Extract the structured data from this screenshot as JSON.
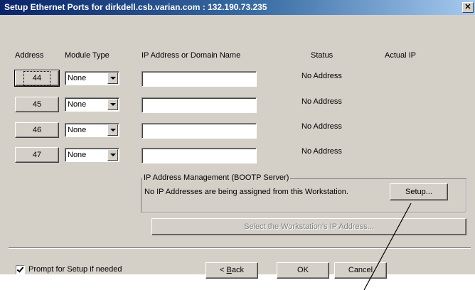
{
  "window": {
    "title": "Setup Ethernet Ports for dirkdell.csb.varian.com : 132.190.73.235",
    "close_glyph": "✕"
  },
  "columns": {
    "address": "Address",
    "module_type": "Module Type",
    "ip_name": "IP Address or Domain Name",
    "status": "Status",
    "actual_ip": "Actual IP"
  },
  "ports": [
    {
      "address": "44",
      "module": "None",
      "ip": "",
      "status": "No Address"
    },
    {
      "address": "45",
      "module": "None",
      "ip": "",
      "status": "No Address"
    },
    {
      "address": "46",
      "module": "None",
      "ip": "",
      "status": "No Address"
    },
    {
      "address": "47",
      "module": "None",
      "ip": "",
      "status": "No Address"
    }
  ],
  "bootp": {
    "group_title": "IP Address Management (BOOTP Server)",
    "message": "No IP Addresses are being assigned from this Workstation.",
    "setup_label": "Setup...",
    "select_ip_label": "Select the Workstation's IP Address..."
  },
  "footer": {
    "prompt_label": "Prompt for Setup if needed",
    "prompt_checked": true,
    "back_prefix": "< ",
    "back_mnemonic": "B",
    "back_rest": "ack",
    "ok_label": "OK",
    "cancel_label": "Cancel"
  }
}
